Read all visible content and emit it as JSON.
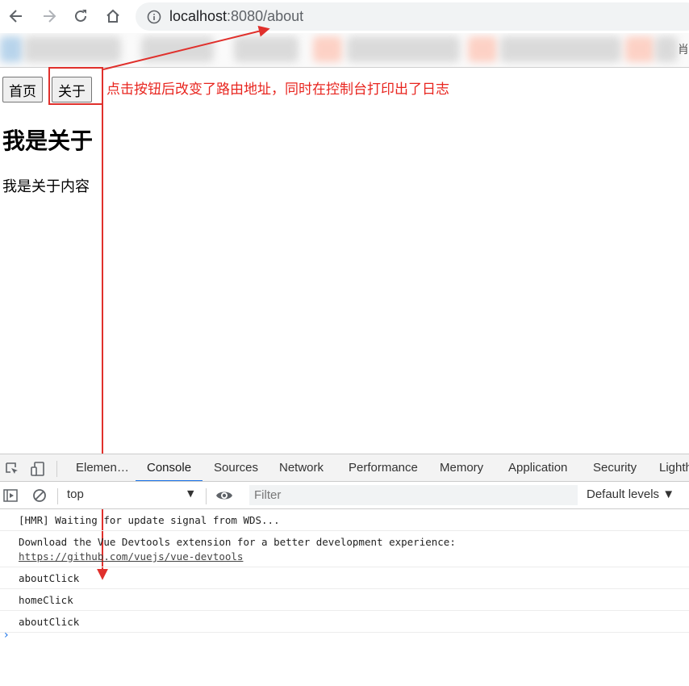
{
  "browser": {
    "url_host": "localhost",
    "url_rest": ":8080/about",
    "bookmark_edge_char": "肖"
  },
  "page": {
    "buttons": [
      {
        "label": "首页"
      },
      {
        "label": "关于"
      }
    ],
    "heading": "我是关于",
    "content": "我是关于内容"
  },
  "annotation": {
    "text": "点击按钮后改变了路由地址，同时在控制台打印出了日志",
    "color": "#e8251f"
  },
  "devtools": {
    "tabs": [
      {
        "label": "Elemen…",
        "active": false
      },
      {
        "label": "Console",
        "active": true
      },
      {
        "label": "Sources",
        "active": false
      },
      {
        "label": "Network",
        "active": false
      },
      {
        "label": "Performance",
        "active": false
      },
      {
        "label": "Memory",
        "active": false
      },
      {
        "label": "Application",
        "active": false
      },
      {
        "label": "Security",
        "active": false
      },
      {
        "label": "Lighth",
        "active": false
      }
    ],
    "context": "top",
    "filter_placeholder": "Filter",
    "levels": "Default levels ▼",
    "messages": [
      {
        "text": "[HMR] Waiting for update signal from WDS..."
      },
      {
        "text": "Download the Vue Devtools extension for a better development experience:",
        "link": "https://github.com/vuejs/vue-devtools"
      },
      {
        "text": "aboutClick"
      },
      {
        "text": "homeClick"
      },
      {
        "text": "aboutClick"
      }
    ],
    "prompt": "›",
    "accent_color": "#1a73e8"
  }
}
